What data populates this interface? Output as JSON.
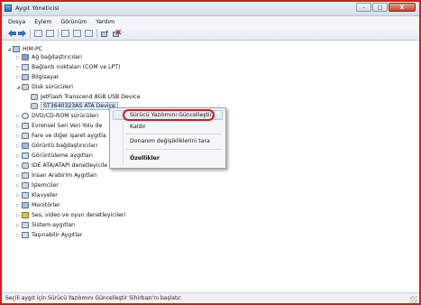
{
  "window": {
    "title": "Aygıt Yöneticisi",
    "controls": [
      "–",
      "□",
      "X"
    ]
  },
  "menu": [
    "Dosya",
    "Eylem",
    "Görünüm",
    "Yardım"
  ],
  "tree": {
    "root": "HIM-PC",
    "items": [
      "Ağ bağdaştırıcıları",
      "Bağlantı noktaları (COM ve LPT)",
      "Bilgisayar",
      "Disk sürücüleri",
      "JetFlash Transcend 8GB USB Device",
      "ST3640323AS ATA Device",
      "DVD/CD-ROM sürücüleri",
      "Evrensel Seri Veri Yolu de",
      "Fare ve diğer işaret aygıtla",
      "Görüntü bağdaştırıcıları",
      "Görüntüleme aygıtları",
      "IDE ATA/ATAPI denetleyicile",
      "İnsan Arabirim Aygıtları",
      "İşlemciler",
      "Klavyeler",
      "Monitörler",
      "Ses, video ve oyun denetleyicileri",
      "Sistem aygıtları",
      "Taşınabilir Aygıtlar"
    ]
  },
  "context_menu": {
    "update": "Sürücü Yazılımını Güncelleştir...",
    "uninstall": "Kaldır",
    "scan": "Donanım değişikliklerini tara",
    "properties": "Özellikler"
  },
  "status": "Seçili aygıt için Sürücü Yazılımını Güncelleştir Sihirbazı'nı başlatır.",
  "colors": {
    "annotation_red": "#e01818",
    "selection_blue": "#dce9f8"
  }
}
